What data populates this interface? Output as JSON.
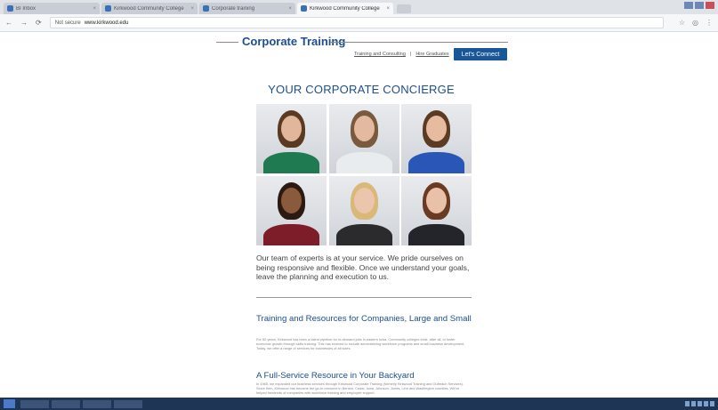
{
  "browser": {
    "tabs": [
      {
        "label": "BI Inbox",
        "active": false
      },
      {
        "label": "Kirkwood Community College",
        "active": false
      },
      {
        "label": "Corporate training",
        "active": false
      },
      {
        "label": "Kirkwood Community College",
        "active": true
      }
    ],
    "url_prefix": "Not secure",
    "url_domain": "www.kirkwood.edu"
  },
  "header": {
    "title": "Corporate Training",
    "link_consulting": "Training and Consulting",
    "link_graduates": "Hire Graduates",
    "separator": "|",
    "cta_label": "Let's Connect",
    "accent_color": "#1d4e8f",
    "button_color": "#1a5799"
  },
  "main": {
    "heading": "YOUR CORPORATE CONCIERGE",
    "photos": [
      {
        "label": "team-member-1",
        "body": "#1f7a52",
        "hair": "#5a3a22",
        "face": "#e2b69a"
      },
      {
        "label": "team-member-2",
        "body": "#e9ecef",
        "hair": "#7a5a3e",
        "face": "#e3b99f"
      },
      {
        "label": "team-member-3",
        "body": "#2a56b8",
        "hair": "#5c3b24",
        "face": "#e6bba0"
      },
      {
        "label": "team-member-4",
        "body": "#7d1d2a",
        "hair": "#2b1a12",
        "face": "#8a5a3c"
      },
      {
        "label": "team-member-5",
        "body": "#2b2b2e",
        "hair": "#d9b878",
        "face": "#ecc5ad"
      },
      {
        "label": "team-member-6",
        "body": "#23252b",
        "hair": "#6b3a22",
        "face": "#e9c1a8"
      }
    ],
    "intro": "Our team of experts is at your service. We pride ourselves on being responsive and flexible. Once we understand your goals, leave the planning and execution to us.",
    "sections": [
      {
        "title": "Training and Resources for Companies, Large and Small",
        "body": "For 50 years, Kirkwood has been a talent pipeline for in-demand jobs in eastern Iowa. Community colleges exist, after all, to foster economic growth through skills training. This has evolved to include administering workforce programs and small business development. Today, we offer a range of services for businesses of all sizes."
      },
      {
        "title": "A Full-Service Resource in Your Backyard",
        "body": "In 1965, we expanded our business services through Kirkwood Corporate Training (formerly Kirkwood Training and Outreach Services). Since then, Kirkwood has become the go-to resource in Benton, Cedar, Iowa, Johnson, Jones, Linn and Washington counties. We've helped hundreds of companies with workforce training and employee support."
      }
    ]
  }
}
